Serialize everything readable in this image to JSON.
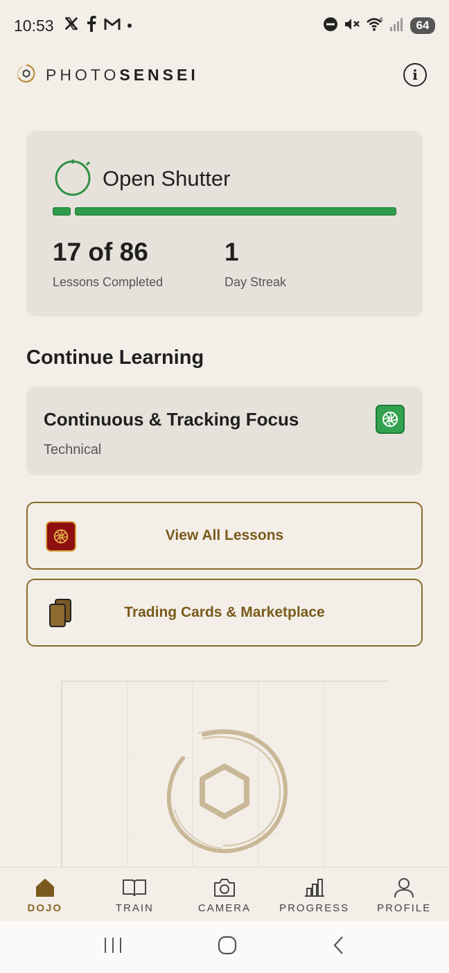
{
  "status_bar": {
    "time": "10:53",
    "notifications": [
      "x-icon",
      "facebook-icon",
      "gmail-icon"
    ],
    "battery": "64"
  },
  "header": {
    "brand_light": "PHOTO",
    "brand_bold": "SENSEI"
  },
  "progress": {
    "rank": "Open Shutter",
    "lessons_value": "17 of 86",
    "lessons_label": "Lessons Completed",
    "streak_value": "1",
    "streak_label": "Day Streak",
    "completed": 17,
    "total": 86,
    "accent": "#2f9a4b"
  },
  "continue_learning": {
    "title": "Continue Learning",
    "lesson_title": "Continuous & Tracking Focus",
    "lesson_category": "Technical"
  },
  "actions": {
    "view_lessons": "View All Lessons",
    "trading_cards": "Trading Cards & Marketplace"
  },
  "nav": {
    "items": [
      {
        "label": "DOJO",
        "icon": "home-icon",
        "active": true
      },
      {
        "label": "TRAIN",
        "icon": "book-icon",
        "active": false
      },
      {
        "label": "CAMERA",
        "icon": "camera-icon",
        "active": false
      },
      {
        "label": "PROGRESS",
        "icon": "chart-icon",
        "active": false
      },
      {
        "label": "PROFILE",
        "icon": "user-icon",
        "active": false
      }
    ]
  },
  "colors": {
    "background": "#f3efe8",
    "card": "#e6e2db",
    "gold": "#8a6a2a",
    "green": "#2f9a4b",
    "red": "#8e1010"
  }
}
